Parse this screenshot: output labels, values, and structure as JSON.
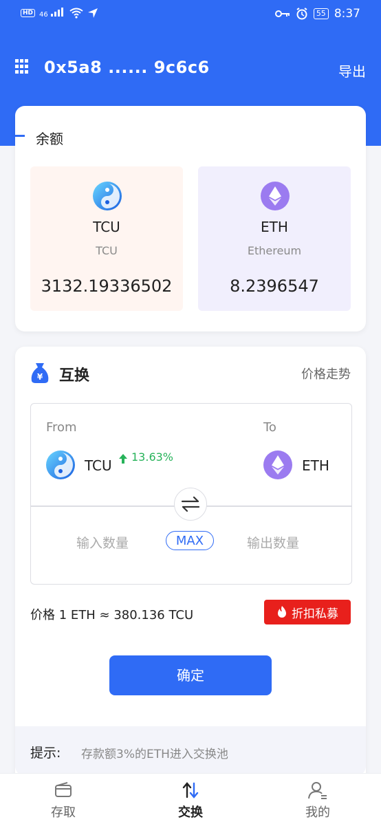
{
  "status_bar": {
    "network": "46",
    "time": "8:37",
    "battery": "55",
    "hd_badge": "HD"
  },
  "header": {
    "address": "0x5a8 ...... 9c6c6",
    "export_label": "导出"
  },
  "balance": {
    "title": "余额",
    "assets": [
      {
        "symbol": "TCU",
        "name": "TCU",
        "amount": "3132.19336502"
      },
      {
        "symbol": "ETH",
        "name": "Ethereum",
        "amount": "8.2396547"
      }
    ]
  },
  "swap": {
    "title": "互换",
    "trend_link": "价格走势",
    "from_label": "From",
    "to_label": "To",
    "from_symbol": "TCU",
    "from_change": "13.63%",
    "to_symbol": "ETH",
    "input_placeholder": "输入数量",
    "max_label": "MAX",
    "output_placeholder": "输出数量",
    "price_text": "价格 1 ETH ≈ 380.136 TCU",
    "discount_label": "折扣私募",
    "confirm_label": "确定"
  },
  "tip": {
    "label": "提示:",
    "text": "存款额3%的ETH进入交换池"
  },
  "tabs": [
    {
      "label": "存取"
    },
    {
      "label": "交换"
    },
    {
      "label": "我的"
    }
  ],
  "colors": {
    "primary": "#2f6bf5",
    "up": "#27b35a",
    "danger": "#e8201c"
  }
}
